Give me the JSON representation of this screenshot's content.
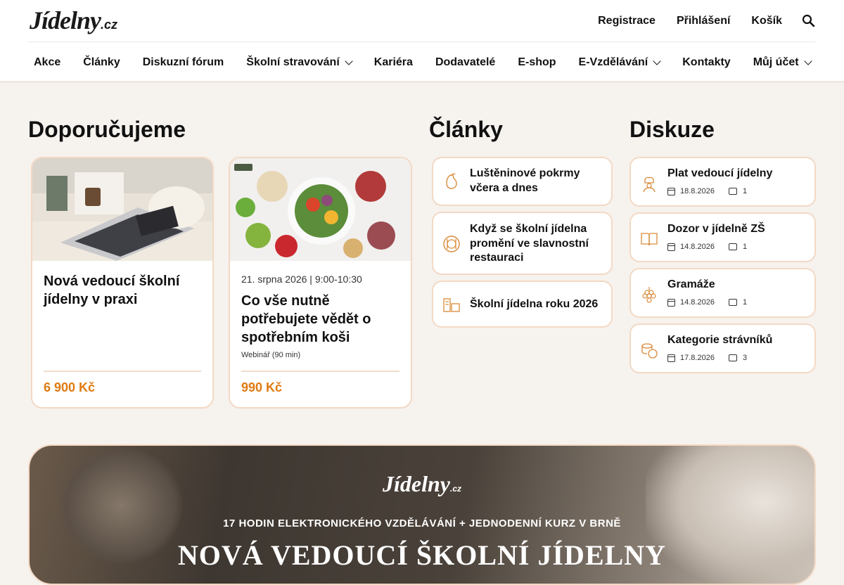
{
  "header": {
    "logo_text": "Jídelny",
    "logo_suffix": ".cz",
    "top_links": [
      "Registrace",
      "Přihlášení",
      "Košík"
    ],
    "nav": [
      {
        "label": "Akce",
        "dropdown": false
      },
      {
        "label": "Články",
        "dropdown": false
      },
      {
        "label": "Diskuzní fórum",
        "dropdown": false
      },
      {
        "label": "Školní stravování",
        "dropdown": true
      },
      {
        "label": "Kariéra",
        "dropdown": false
      },
      {
        "label": "Dodavatelé",
        "dropdown": false
      },
      {
        "label": "E-shop",
        "dropdown": false
      },
      {
        "label": "E-Vzdělávání",
        "dropdown": true
      },
      {
        "label": "Kontakty",
        "dropdown": false
      },
      {
        "label": "Můj účet",
        "dropdown": true
      }
    ]
  },
  "recommended": {
    "heading": "Doporučujeme",
    "cards": [
      {
        "title": "Nová vedoucí školní jídelny v praxi",
        "price": "6 900 Kč"
      },
      {
        "date": "21. srpna 2026 | 9:00-10:30",
        "title": "Co vše nutně potřebujete vědět o spotřebním koši",
        "subtitle": "Webinář (90 min)",
        "price": "990 Kč"
      }
    ]
  },
  "articles": {
    "heading": "Články",
    "items": [
      {
        "title": "Luštěninové pokrmy včera a dnes",
        "icon": "bean-icon"
      },
      {
        "title": "Když se školní jídelna promění ve slavnostní restauraci",
        "icon": "plate-cutlery-icon"
      },
      {
        "title": "Školní jídelna roku 2026",
        "icon": "canteen-icon"
      }
    ]
  },
  "discussion": {
    "heading": "Diskuze",
    "items": [
      {
        "title": "Plat vedoucí jídelny",
        "date": "18.8.2026",
        "comments": "1",
        "icon": "chef-icon"
      },
      {
        "title": "Dozor v jídelně ZŠ",
        "date": "14.8.2026",
        "comments": "1",
        "icon": "book-icon"
      },
      {
        "title": "Gramáže",
        "date": "14.8.2026",
        "comments": "1",
        "icon": "grapes-icon"
      },
      {
        "title": "Kategorie strávníků",
        "date": "17.8.2026",
        "comments": "3",
        "icon": "coins-icon"
      }
    ]
  },
  "banner": {
    "logo_text": "Jídelny",
    "logo_suffix": ".cz",
    "line1": "17 HODIN ELEKTRONICKÉHO VZDĚLÁVÁNÍ + JEDNODENNÍ KURZ V BRNĚ",
    "line2": "NOVÁ VEDOUCÍ ŠKOLNÍ JÍDELNY"
  },
  "colors": {
    "accent": "#e07a12",
    "border": "#f3d9c4",
    "background": "#f6f2ee"
  }
}
